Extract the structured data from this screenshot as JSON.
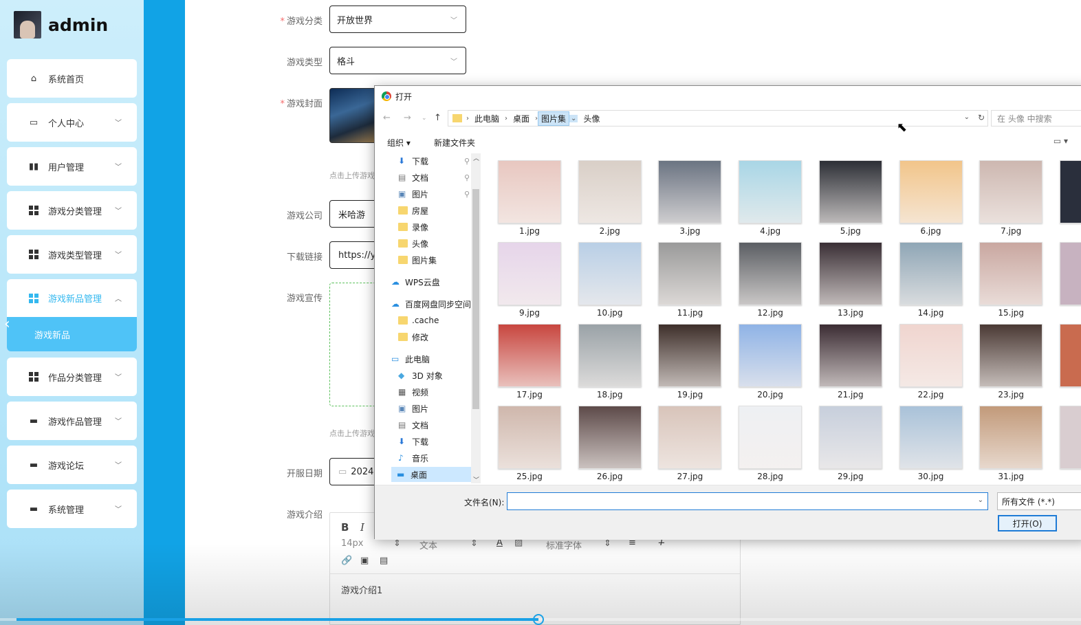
{
  "brand": {
    "name": "admin"
  },
  "sidebar": {
    "items": [
      {
        "label": "系统首页",
        "icon": "home-icon"
      },
      {
        "label": "个人中心",
        "icon": "card-icon"
      },
      {
        "label": "用户管理",
        "icon": "books-icon"
      },
      {
        "label": "游戏分类管理",
        "icon": "grid-icon"
      },
      {
        "label": "游戏类型管理",
        "icon": "grid-icon"
      },
      {
        "label": "游戏新品管理",
        "icon": "grid-icon"
      },
      {
        "label": "作品分类管理",
        "icon": "grid-icon"
      },
      {
        "label": "游戏作品管理",
        "icon": "chat-icon"
      },
      {
        "label": "游戏论坛",
        "icon": "monitor-icon"
      },
      {
        "label": "系统管理",
        "icon": "monitor-icon"
      }
    ],
    "sub_active": "游戏新品"
  },
  "form": {
    "category_label": "游戏分类",
    "category_value": "开放世界",
    "type_label": "游戏类型",
    "type_value": "格斗",
    "cover_label": "游戏封面",
    "upload_hint": "点击上传游戏",
    "company_label": "游戏公司",
    "company_value": "米哈游",
    "link_label": "下载链接",
    "link_value": "https://ys",
    "promo_label": "游戏宣传",
    "upload_hint2": "点击上传游戏",
    "date_label": "开服日期",
    "date_value": "2024",
    "intro_label": "游戏介绍",
    "editor": {
      "bold": "B",
      "italic": "I",
      "fontsize": "14px",
      "text_style": "文本",
      "font_family": "标准字体",
      "content": "游戏介绍1"
    }
  },
  "dialog": {
    "title": "打开",
    "path": [
      "此电脑",
      "桌面",
      "图片集",
      "头像"
    ],
    "search_placeholder": "在 头像 中搜索",
    "organize": "组织",
    "new_folder": "新建文件夹",
    "tree": [
      {
        "label": "下载",
        "icon": "download-icon",
        "pinned": true
      },
      {
        "label": "文档",
        "icon": "document-icon",
        "pinned": true
      },
      {
        "label": "图片",
        "icon": "picture-icon",
        "pinned": true
      },
      {
        "label": "房屋",
        "icon": "folder-icon"
      },
      {
        "label": "录像",
        "icon": "folder-icon"
      },
      {
        "label": "头像",
        "icon": "folder-icon"
      },
      {
        "label": "图片集",
        "icon": "folder-icon"
      },
      {
        "label": "WPS云盘",
        "icon": "cloud-icon"
      },
      {
        "label": "百度网盘同步空间",
        "icon": "cloud-icon"
      },
      {
        "label": ".cache",
        "icon": "folder-icon"
      },
      {
        "label": "修改",
        "icon": "folder-icon"
      },
      {
        "label": "此电脑",
        "icon": "computer-icon"
      },
      {
        "label": "3D 对象",
        "icon": "cube-icon"
      },
      {
        "label": "视频",
        "icon": "video-icon"
      },
      {
        "label": "图片",
        "icon": "picture-icon"
      },
      {
        "label": "文档",
        "icon": "document-icon"
      },
      {
        "label": "下载",
        "icon": "download-icon"
      },
      {
        "label": "音乐",
        "icon": "music-icon"
      },
      {
        "label": "桌面",
        "icon": "desktop-icon",
        "selected": true
      }
    ],
    "files": [
      {
        "name": "1.jpg",
        "color": "#e8c7c0"
      },
      {
        "name": "2.jpg",
        "color": "#d9cfc7"
      },
      {
        "name": "3.jpg",
        "color": "#6b7482"
      },
      {
        "name": "4.jpg",
        "color": "#a9d6e6"
      },
      {
        "name": "5.jpg",
        "color": "#2d2f36"
      },
      {
        "name": "6.jpg",
        "color": "#f2c58a"
      },
      {
        "name": "7.jpg",
        "color": "#cdb7b0"
      },
      {
        "name": "9.jpg",
        "color": "#e6d5ea"
      },
      {
        "name": "10.jpg",
        "color": "#b9cfe6"
      },
      {
        "name": "11.jpg",
        "color": "#9a9a9a"
      },
      {
        "name": "12.jpg",
        "color": "#5b5e63"
      },
      {
        "name": "13.jpg",
        "color": "#3a2f35"
      },
      {
        "name": "14.jpg",
        "color": "#8fa6b6"
      },
      {
        "name": "15.jpg",
        "color": "#c9a7a0"
      },
      {
        "name": "17.jpg",
        "color": "#c8463f"
      },
      {
        "name": "18.jpg",
        "color": "#9aa2a7"
      },
      {
        "name": "19.jpg",
        "color": "#3e2f2a"
      },
      {
        "name": "20.jpg",
        "color": "#8fb3e6"
      },
      {
        "name": "21.jpg",
        "color": "#3b2c33"
      },
      {
        "name": "22.jpg",
        "color": "#f0d5cf"
      },
      {
        "name": "23.jpg",
        "color": "#4a3934"
      },
      {
        "name": "25.jpg",
        "color": "#cfb7ac"
      },
      {
        "name": "26.jpg",
        "color": "#5d4a49"
      },
      {
        "name": "27.jpg",
        "color": "#d8c4ba"
      },
      {
        "name": "28.jpg",
        "color": "#eef0f3"
      },
      {
        "name": "29.jpg",
        "color": "#c7cfdc"
      },
      {
        "name": "30.jpg",
        "color": "#a9c2d9"
      },
      {
        "name": "31.jpg",
        "color": "#c29a7a"
      }
    ],
    "filename_label": "文件名(N):",
    "filename_value": "",
    "filetype": "所有文件 (*.*)",
    "open_button": "打开(O)"
  },
  "video": {
    "progress": 0.49
  }
}
